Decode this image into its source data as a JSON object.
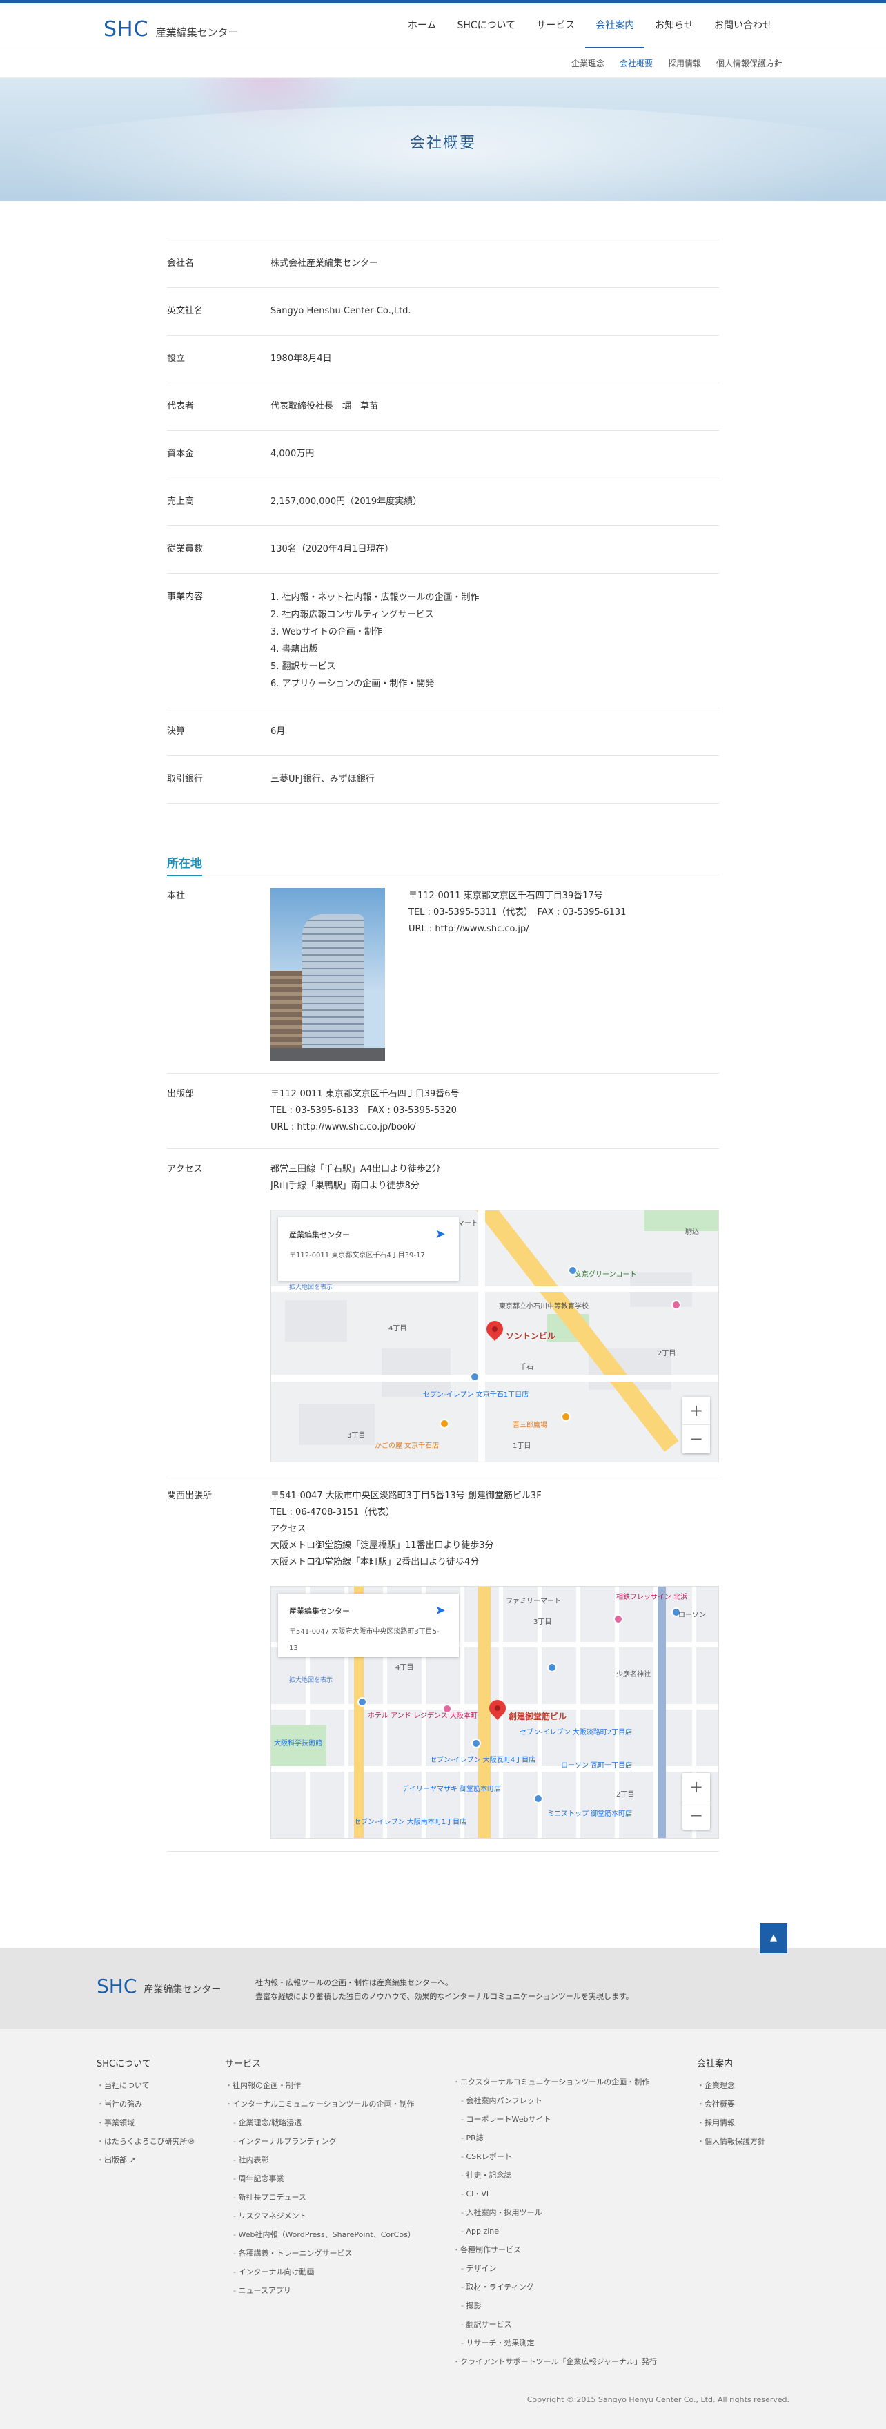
{
  "header": {
    "logo_text": "SHC",
    "logo_sub": "産業編集センター",
    "nav": [
      "ホーム",
      "SHCについて",
      "サービス",
      "会社案内",
      "お知らせ",
      "お問い合わせ"
    ],
    "subnav": [
      "企業理念",
      "会社概要",
      "採用情報",
      "個人情報保護方針"
    ]
  },
  "hero": {
    "title": "会社概要"
  },
  "company": [
    {
      "label": "会社名",
      "value": "株式会社産業編集センター"
    },
    {
      "label": "英文社名",
      "value": "Sangyo Henshu Center Co.,Ltd."
    },
    {
      "label": "設立",
      "value": "1980年8月4日"
    },
    {
      "label": "代表者",
      "value": "代表取締役社長　堀　草苗"
    },
    {
      "label": "資本金",
      "value": "4,000万円"
    },
    {
      "label": "売上高",
      "value": "2,157,000,000円（2019年度実績）"
    },
    {
      "label": "従業員数",
      "value": "130名（2020年4月1日現在）"
    }
  ],
  "business": {
    "label": "事業内容",
    "items": [
      "1. 社内報・ネット社内報・広報ツールの企画・制作",
      "2. 社内報広報コンサルティングサービス",
      "3. Webサイトの企画・制作",
      "4. 書籍出版",
      "5. 翻訳サービス",
      "6. アプリケーションの企画・制作・開発"
    ]
  },
  "company2": [
    {
      "label": "決算",
      "value": "6月"
    },
    {
      "label": "取引銀行",
      "value": "三菱UFJ銀行、みずほ銀行"
    }
  ],
  "location": {
    "title": "所在地",
    "hq": {
      "label": "本社",
      "lines": [
        "〒112-0011 東京都文京区千石四丁目39番17号",
        "TEL : 03-5395-5311（代表）　FAX : 03-5395-6131",
        "URL : http://www.shc.co.jp/"
      ]
    },
    "publishing": {
      "label": "出版部",
      "lines": [
        "〒112-0011 東京都文京区千石四丁目39番6号",
        "TEL : 03-5395-6133　FAX : 03-5395-5320",
        "URL : http://www.shc.co.jp/book/"
      ]
    },
    "access": {
      "label": "アクセス",
      "lines": [
        "都営三田線「千石駅」A4出口より徒歩2分",
        "JR山手線「巣鴨駅」南口より徒歩8分"
      ]
    },
    "map1": {
      "card_title": "産業編集センター",
      "card_addr": "〒112-0011 東京都文京区千石4丁目39-17",
      "card_link": "拡大地図を表示",
      "dir": "経路",
      "pin_label": "ソントンビル",
      "labels": [
        "ファミリーマート",
        "文京グリーンコート",
        "東京都立小石川中等教育学校",
        "千石",
        "セブン-イレブン 文京千石1丁目店",
        "かごの屋 文京千石店",
        "吾三郎鷹場",
        "4丁目",
        "2丁目",
        "3丁目",
        "1丁目",
        "駒込"
      ]
    },
    "kansai": {
      "label": "関西出張所",
      "lines": [
        "〒541-0047 大阪市中央区淡路町3丁目5番13号 創建御堂筋ビル3F",
        "TEL : 06-4708-3151（代表）",
        "アクセス",
        "大阪メトロ御堂筋線「淀屋橋駅」11番出口より徒歩3分",
        "大阪メトロ御堂筋線「本町駅」2番出口より徒歩4分"
      ]
    },
    "map2": {
      "card_title": "産業編集センター",
      "card_addr": "〒541-0047 大阪府大阪市中央区淡路町3丁目5-13",
      "card_link": "拡大地図を表示",
      "dir": "経路",
      "pin_label": "創建御堂筋ビル",
      "labels": [
        "ファミリーマート",
        "相鉄フレッサイン 北浜",
        "ローソン",
        "少彦名神社",
        "ホテル アンド レジデンス 大阪本町",
        "セブン-イレブン 大阪淡路町2丁目店",
        "セブン-イレブン 大阪瓦町4丁目店",
        "ローソン 瓦町一丁目店",
        "デイリーヤマザキ 御堂筋本町店",
        "ミニストップ 御堂筋本町店",
        "大阪科学技術館",
        "セブン-イレブン 大阪南本町1丁目店",
        "4丁目",
        "3丁目",
        "2丁目"
      ]
    }
  },
  "footer": {
    "logo_text": "SHC",
    "logo_sub": "産業編集センター",
    "message": [
      "社内報・広報ツールの企画・制作は産業編集センターへ。",
      "豊富な経験により蓄積した独自のノウハウで、効果的なインターナルコミュニケーションツールを実現します。"
    ],
    "about": {
      "title": "SHCについて",
      "items": [
        "当社について",
        "当社の強み",
        "事業領域",
        "はたらくよろこび研究所®",
        "出版部 ↗"
      ]
    },
    "services": {
      "title": "サービス",
      "items": [
        "社内報の企画・制作",
        "インターナルコミュニケーションツールの企画・制作",
        "企業理念/戦略浸透",
        "インターナルブランディング",
        "社内表彰",
        "周年記念事業",
        "新社長プロデュース",
        "リスクマネジメント",
        "Web社内報（WordPress、SharePoint、CorCos）",
        "各種講義・トレーニングサービス",
        "インターナル向け動画",
        "ニュースアプリ"
      ]
    },
    "services2": {
      "items": [
        "エクスターナルコミュニケーションツールの企画・制作"
      ],
      "sub1": [
        "会社案内パンフレット",
        "コーポレートWebサイト",
        "PR誌",
        "CSRレポート",
        "社史・記念誌",
        "CI・VI",
        "入社案内・採用ツール",
        "App zine"
      ],
      "item2": "各種制作サービス",
      "sub2": [
        "デザイン",
        "取材・ライティング",
        "撮影",
        "翻訳サービス",
        "リサーチ・効果測定"
      ],
      "item3": "クライアントサポートツール「企業広報ジャーナル」発行"
    },
    "company": {
      "title": "会社案内",
      "items": [
        "企業理念",
        "会社概要",
        "採用情報",
        "個人情報保護方針"
      ]
    },
    "copyright": "Copyright © 2015 Sangyo Henyu Center Co., Ltd. All rights reserved.",
    "pagetop": "▲"
  }
}
